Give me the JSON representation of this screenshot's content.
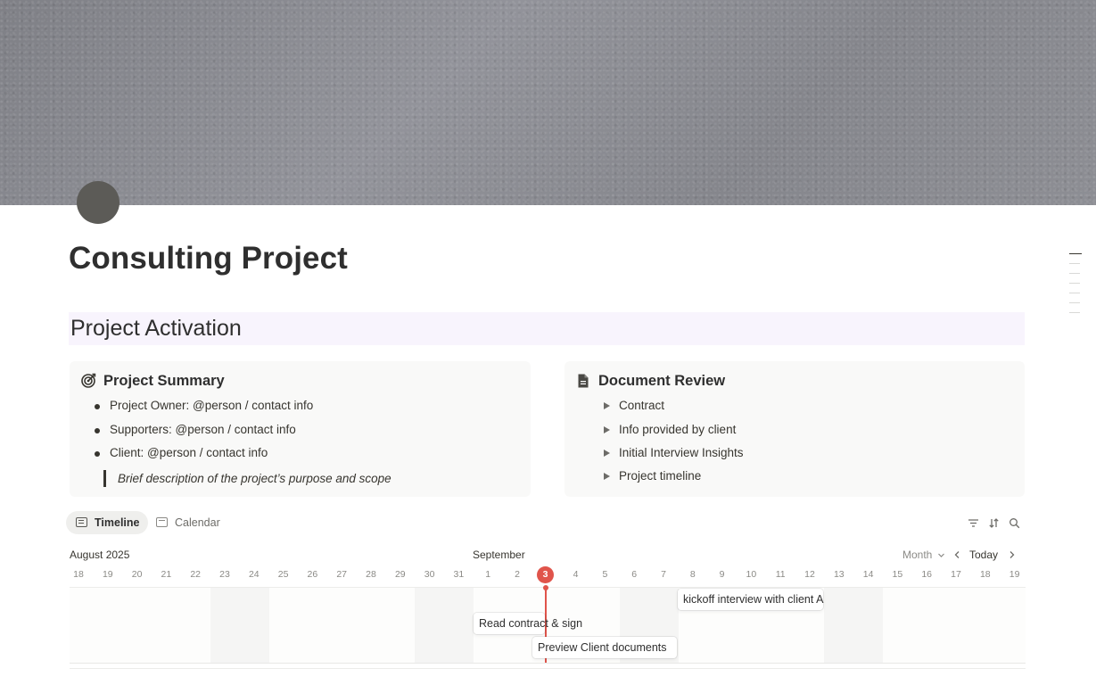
{
  "page": {
    "title": "Consulting Project",
    "icon": "circle-icon"
  },
  "section": {
    "heading": "Project Activation"
  },
  "summary": {
    "title": "Project Summary",
    "icon": "target-icon",
    "bullets": [
      "Project Owner: @person / contact info",
      "Supporters: @person / contact info",
      "Client: @person / contact info"
    ],
    "quote": "Brief description of the project’s purpose and scope"
  },
  "documents": {
    "title": "Document Review",
    "icon": "document-icon",
    "toggles": [
      "Contract",
      "Info provided by client",
      "Initial Interview Insights",
      "Project timeline"
    ]
  },
  "views": {
    "tabs": [
      {
        "label": "Timeline",
        "icon": "timeline-icon",
        "active": true
      },
      {
        "label": "Calendar",
        "icon": "calendar-icon",
        "active": false
      }
    ],
    "tools": [
      "filter-icon",
      "sort-icon",
      "search-icon"
    ]
  },
  "timeline": {
    "month_labels": [
      "August 2025",
      "September"
    ],
    "scale": "Month",
    "today_label": "Today",
    "days": [
      "18",
      "19",
      "20",
      "21",
      "22",
      "23",
      "24",
      "25",
      "26",
      "27",
      "28",
      "29",
      "30",
      "31",
      "1",
      "2",
      "3",
      "4",
      "5",
      "6",
      "7",
      "8",
      "9",
      "10",
      "11",
      "12",
      "13",
      "14",
      "15",
      "16",
      "17",
      "18",
      "19"
    ],
    "today": "3",
    "today_color": "#e0544b",
    "events": [
      {
        "label": "kickoff interview with client A"
      },
      {
        "label": "Read contract & sign"
      },
      {
        "label": "Preview Client documents"
      }
    ]
  }
}
